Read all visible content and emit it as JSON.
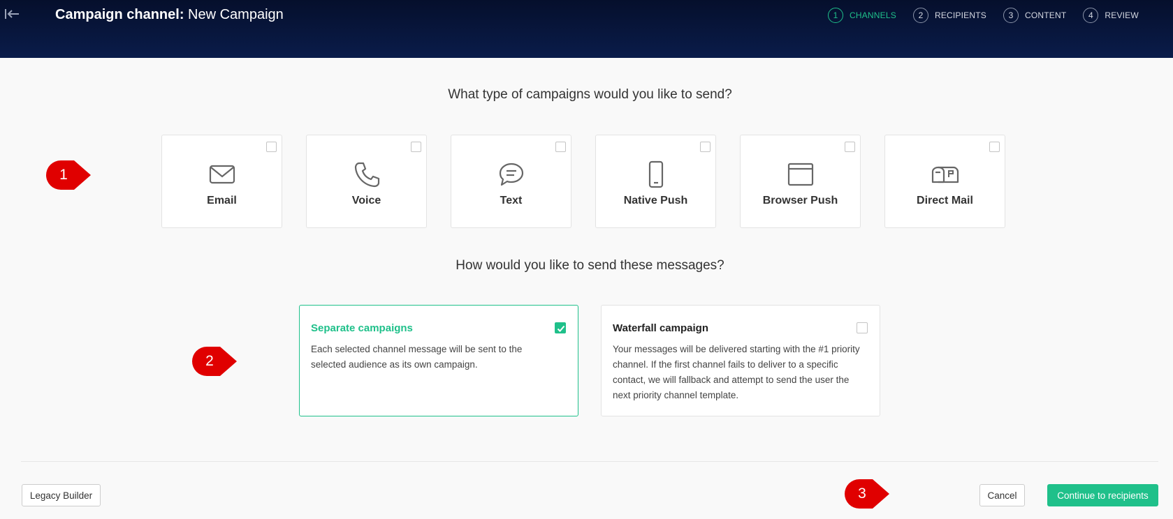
{
  "header": {
    "title_prefix": "Campaign channel:",
    "title_name": "New Campaign",
    "steps": [
      {
        "num": "1",
        "label": "CHANNELS",
        "active": true
      },
      {
        "num": "2",
        "label": "RECIPIENTS",
        "active": false
      },
      {
        "num": "3",
        "label": "CONTENT",
        "active": false
      },
      {
        "num": "4",
        "label": "REVIEW",
        "active": false
      }
    ]
  },
  "channels_question": "What type of campaigns would you like to send?",
  "channels": [
    {
      "label": "Email",
      "icon": "envelope-icon",
      "checked": false
    },
    {
      "label": "Voice",
      "icon": "phone-icon",
      "checked": false
    },
    {
      "label": "Text",
      "icon": "chat-bubble-icon",
      "checked": false
    },
    {
      "label": "Native Push",
      "icon": "mobile-phone-icon",
      "checked": false
    },
    {
      "label": "Browser Push",
      "icon": "browser-window-icon",
      "checked": false
    },
    {
      "label": "Direct Mail",
      "icon": "mailbox-icon",
      "checked": false
    }
  ],
  "send_question": "How would you like to send these messages?",
  "send_modes": [
    {
      "title": "Separate campaigns",
      "description": "Each selected channel message will be sent to the selected audience as its own campaign.",
      "checked": true
    },
    {
      "title": "Waterfall campaign",
      "description": "Your messages will be delivered starting with the #1 priority channel. If the first channel fails to deliver to a specific contact, we will fallback and attempt to send the user the next priority channel template.",
      "checked": false
    }
  ],
  "markers": [
    "1",
    "2",
    "3"
  ],
  "footer": {
    "legacy_label": "Legacy Builder",
    "cancel_label": "Cancel",
    "continue_label": "Continue to recipients"
  },
  "colors": {
    "accent": "#1fc08a",
    "header_bg": "#06122f",
    "marker": "#e00000"
  }
}
